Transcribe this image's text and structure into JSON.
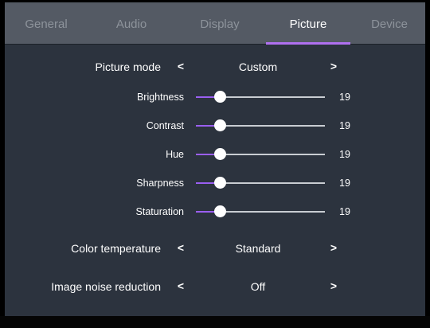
{
  "tabs": [
    {
      "label": "General",
      "active": false
    },
    {
      "label": "Audio",
      "active": false
    },
    {
      "label": "Display",
      "active": false
    },
    {
      "label": "Picture",
      "active": true
    },
    {
      "label": "Device",
      "active": false
    }
  ],
  "picture_mode": {
    "label": "Picture mode",
    "value": "Custom",
    "prev_glyph": "<",
    "next_glyph": ">"
  },
  "sliders": {
    "min": 0,
    "max": 100,
    "items": [
      {
        "label": "Brightness",
        "value": 19
      },
      {
        "label": "Contrast",
        "value": 19
      },
      {
        "label": "Hue",
        "value": 19
      },
      {
        "label": "Sharpness",
        "value": 19
      },
      {
        "label": "Staturation",
        "value": 19
      }
    ]
  },
  "color_temperature": {
    "label": "Color temperature",
    "value": "Standard",
    "prev_glyph": "<",
    "next_glyph": ">"
  },
  "noise_reduction": {
    "label": "Image noise reduction",
    "value": "Off",
    "prev_glyph": "<",
    "next_glyph": ">"
  },
  "colors": {
    "accent": "#9a5ff0",
    "tab_underline": "#b070f0",
    "panel_bg": "#2c333e",
    "tabbar_bg": "#545a64",
    "inactive_tab_text": "#8d939b"
  }
}
